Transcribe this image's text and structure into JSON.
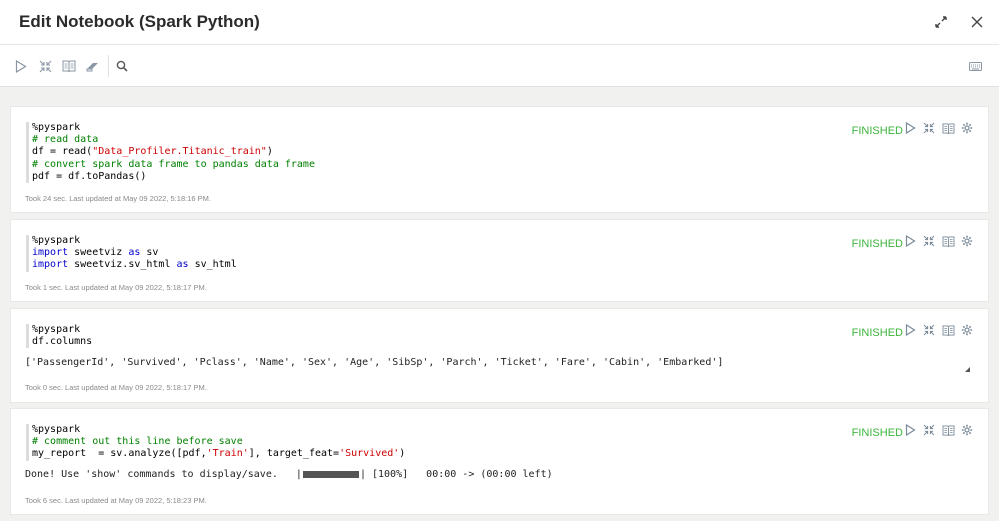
{
  "header": {
    "title": "Edit Notebook (Spark Python)"
  },
  "paragraphs": [
    {
      "status": "FINISHED",
      "code": [
        [
          {
            "t": "%pyspark",
            "c": ""
          }
        ],
        [
          {
            "t": "# read data",
            "c": "cm"
          }
        ],
        [
          {
            "t": "df = read(",
            "c": ""
          },
          {
            "t": "\"Data_Profiler.Titanic_train\"",
            "c": "st"
          },
          {
            "t": ")",
            "c": ""
          }
        ],
        [
          {
            "t": "# convert spark data frame to pandas data frame",
            "c": "cm"
          }
        ],
        [
          {
            "t": "pdf = df.toPandas()",
            "c": ""
          }
        ]
      ],
      "output": "",
      "footer": "Took 24 sec. Last updated at May 09 2022, 5:18:16 PM."
    },
    {
      "status": "FINISHED",
      "code": [
        [
          {
            "t": "%pyspark",
            "c": ""
          }
        ],
        [
          {
            "t": "import",
            "c": "kw"
          },
          {
            "t": " sweetviz ",
            "c": ""
          },
          {
            "t": "as",
            "c": "kw"
          },
          {
            "t": " sv",
            "c": ""
          }
        ],
        [
          {
            "t": "import",
            "c": "kw"
          },
          {
            "t": " sweetviz.sv_html ",
            "c": ""
          },
          {
            "t": "as",
            "c": "kw"
          },
          {
            "t": " sv_html",
            "c": ""
          }
        ]
      ],
      "output": "",
      "footer": "Took 1 sec. Last updated at May 09 2022, 5:18:17 PM."
    },
    {
      "status": "FINISHED",
      "code": [
        [
          {
            "t": "%pyspark",
            "c": ""
          }
        ],
        [
          {
            "t": "df.columns",
            "c": ""
          }
        ]
      ],
      "output": "['PassengerId', 'Survived', 'Pclass', 'Name', 'Sex', 'Age', 'SibSp', 'Parch', 'Ticket', 'Fare', 'Cabin', 'Embarked']",
      "footer": "Took 0 sec. Last updated at May 09 2022, 5:18:17 PM."
    },
    {
      "status": "FINISHED",
      "code": [
        [
          {
            "t": "%pyspark",
            "c": ""
          }
        ],
        [
          {
            "t": "# comment out this line before save",
            "c": "cm"
          }
        ],
        [
          {
            "t": "my_report  = sv.analyze([pdf,",
            "c": ""
          },
          {
            "t": "'Train'",
            "c": "st"
          },
          {
            "t": "], target_feat=",
            "c": ""
          },
          {
            "t": "'Survived'",
            "c": "st"
          },
          {
            "t": ")",
            "c": ""
          }
        ]
      ],
      "output_pre": "Done! Use 'show' commands to display/save.   |",
      "output_post": "| [100%]   00:00 -> (00:00 left)",
      "progress": 1.0,
      "footer": "Took 6 sec. Last updated at May 09 2022, 5:18:23 PM."
    }
  ],
  "icons": {
    "expand": "expand-icon",
    "close": "close-icon",
    "run": "play-icon",
    "hide_code": "collapse-icon",
    "hide_output": "book-icon",
    "clear": "eraser-icon",
    "search": "search-icon",
    "keyboard": "keyboard-icon",
    "settings": "gear-icon"
  },
  "colors": {
    "status_finished": "#3cb53c",
    "icon": "#7a8a99"
  }
}
